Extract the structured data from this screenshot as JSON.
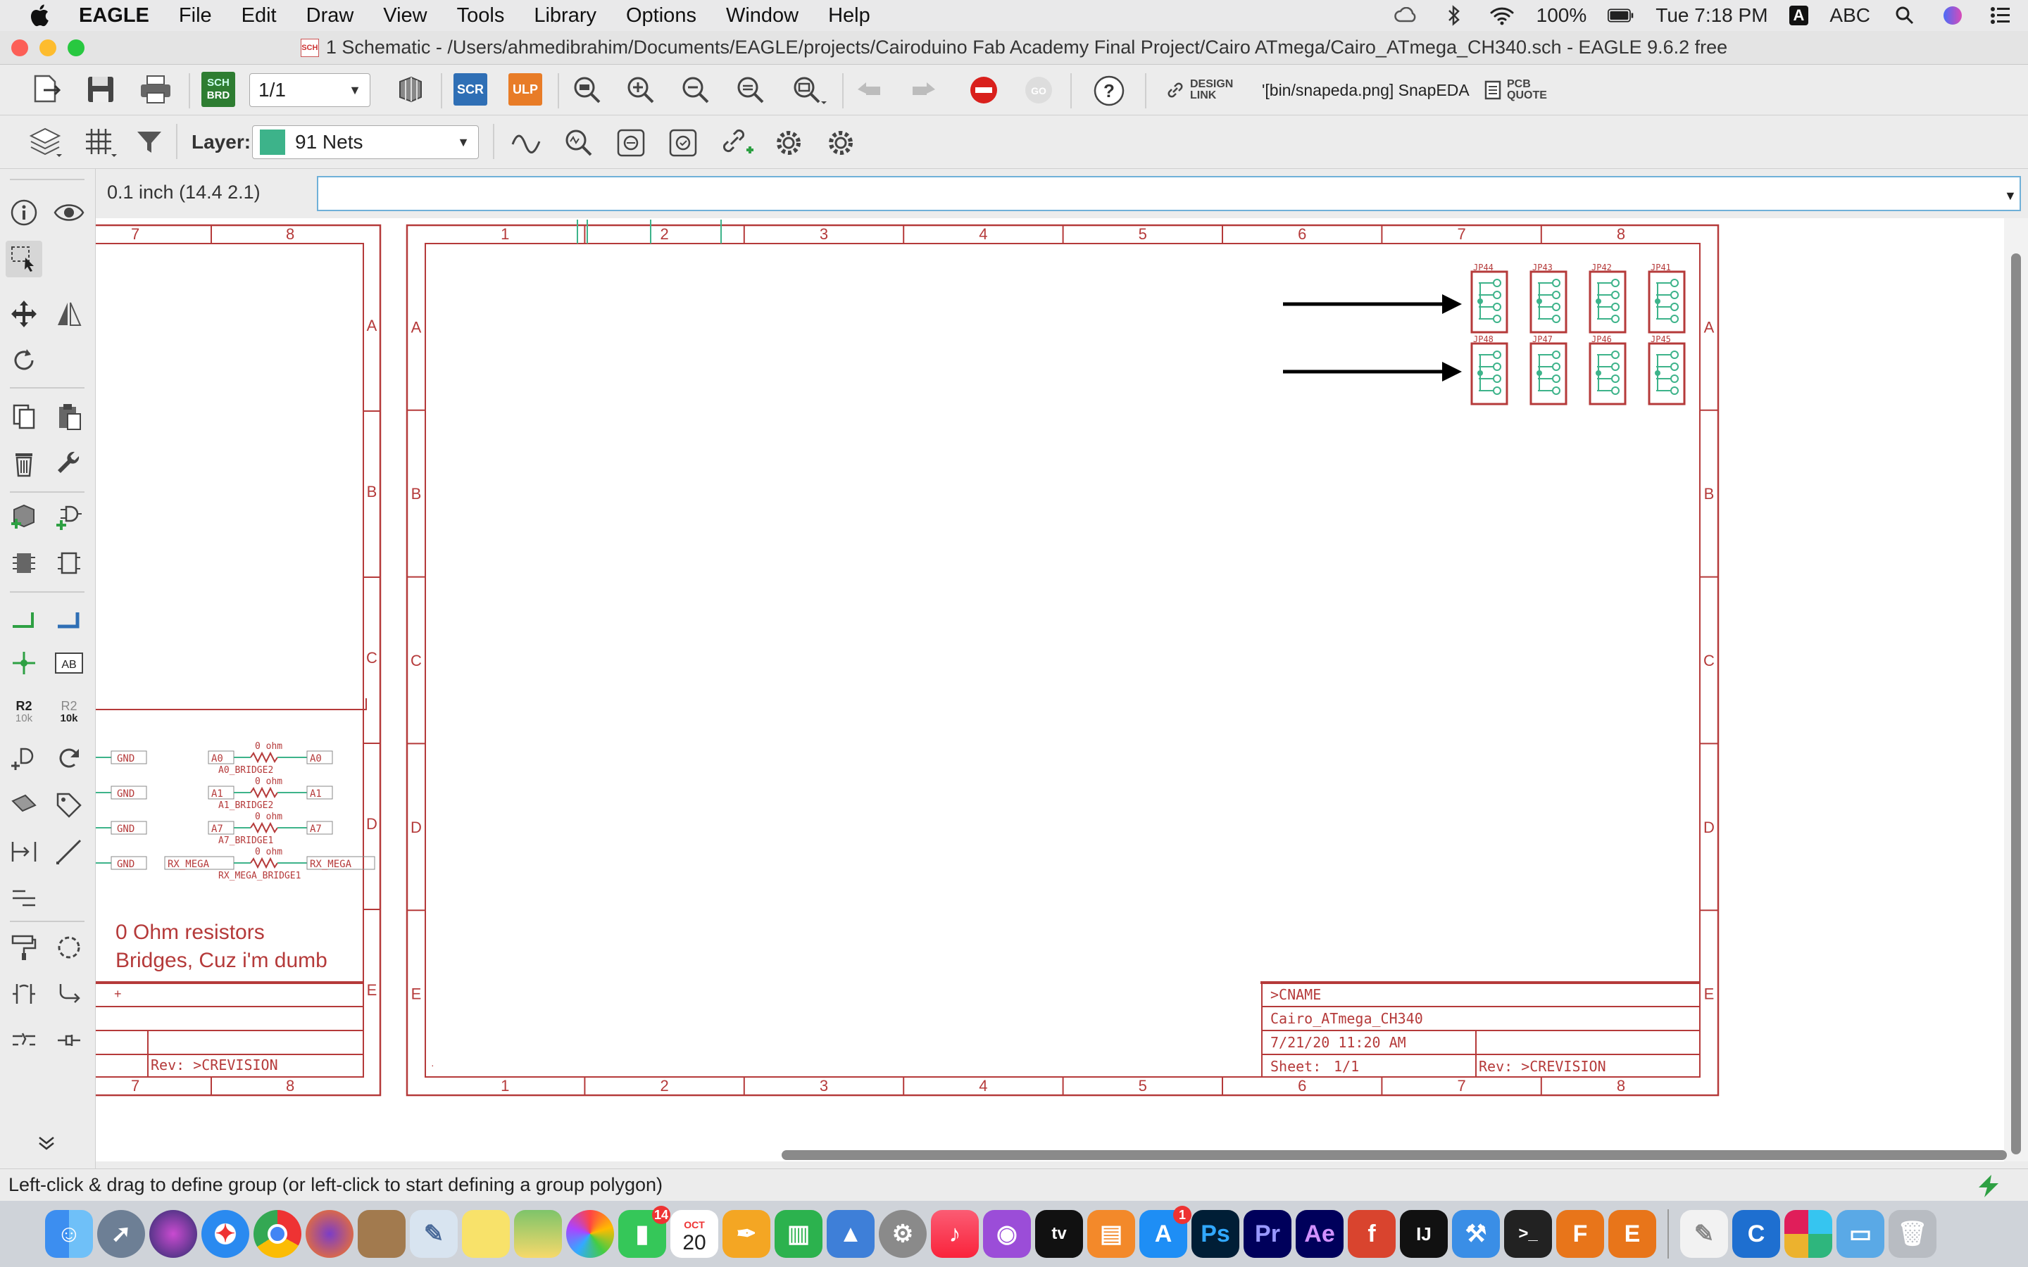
{
  "menubar": {
    "app_name": "EAGLE",
    "items": [
      "File",
      "Edit",
      "Draw",
      "View",
      "Tools",
      "Library",
      "Options",
      "Window",
      "Help"
    ],
    "battery": "100%",
    "clock": "Tue 7:18 PM",
    "input_source": "ABC",
    "input_badge": "A"
  },
  "window": {
    "title": "1 Schematic - /Users/ahmedibrahim/Documents/EAGLE/projects/Cairoduino Fab Academy Final Project/Cairo ATmega/Cairo_ATmega_CH340.sch - EAGLE 9.6.2 free"
  },
  "toolbar": {
    "sheet_select": "1/1",
    "scr_label": "SCR",
    "ulp_label": "ULP",
    "sch_brd_top": "SCH",
    "sch_brd_bottom": "BRD",
    "design_link": "DESIGN\nLINK",
    "snapeda": "'[bin/snapeda.png] SnapEDA",
    "pcb_quote": "PCB\nQUOTE",
    "layer_label": "Layer:",
    "layer_value": "91 Nets",
    "layer_color": "#3db38a"
  },
  "command": {
    "coordinate": "0.1 inch (14.4 2.1)",
    "value": ""
  },
  "palette": {
    "value_top": "R2",
    "value_bottom": "10k",
    "value_top2": "R2",
    "value_bottom2": "10k",
    "text_tool": "AB"
  },
  "schematic": {
    "col_labels": [
      "1",
      "2",
      "3",
      "4",
      "5",
      "6",
      "7",
      "8"
    ],
    "left_col_labels": [
      "7",
      "8"
    ],
    "row_labels": [
      "A",
      "B",
      "C",
      "D",
      "E"
    ],
    "pin_headers_top": [
      "JP44",
      "JP43",
      "JP42",
      "JP41"
    ],
    "pin_headers_bottom": [
      "JP48",
      "JP47",
      "JP46",
      "JP45"
    ],
    "bridges": [
      {
        "left": "A0",
        "right": "A0",
        "name": "A0_BRIDGE2",
        "value": "0 ohm",
        "gnd": "GND"
      },
      {
        "left": "A1",
        "right": "A1",
        "name": "A1_BRIDGE2",
        "value": "0 ohm",
        "gnd": "GND"
      },
      {
        "left": "A7",
        "right": "A7",
        "name": "A7_BRIDGE1",
        "value": "0 ohm",
        "gnd": "GND"
      },
      {
        "left": "RX_MEGA",
        "right": "RX_MEGA",
        "name": "RX_MEGA_BRIDGE1",
        "value": "0 ohm",
        "gnd": "GND"
      }
    ],
    "note_line1": "0 Ohm resistors",
    "note_line2": "Bridges, Cuz i'm dumb",
    "title_block": {
      "cname": ">CNAME",
      "filename": "Cairo_ATmega_CH340",
      "date": "7/21/20 11:20 AM",
      "sheet_label": "Sheet:",
      "sheet_value": "1/1",
      "revision": "Rev: >CREVISION"
    },
    "left_title_revision": "Rev: >CREVISION",
    "colors": {
      "frame": "#b53a3a",
      "net": "#3db38a",
      "arrow": "#000000"
    }
  },
  "status": {
    "message": "Left-click & drag to define group (or left-click to start defining a group polygon)"
  },
  "dock": {
    "facetime_badge": "14",
    "calendar_month": "OCT",
    "calendar_day": "20",
    "appstore_badge": "1",
    "apps": [
      "Finder",
      "Launchpad",
      "Siri",
      "Safari",
      "Chrome",
      "Firefox",
      "Notes",
      "Preview",
      "Stickies",
      "Maps",
      "Photos",
      "FaceTime",
      "Calendar",
      "Pages",
      "Numbers",
      "Keynote",
      "System Preferences",
      "Music",
      "Podcasts",
      "TV",
      "Books",
      "App Store",
      "Ps",
      "Pr",
      "Ae",
      "Fusion",
      "IntelliJ",
      "Xcode",
      "Terminal",
      "F360",
      "EAGLE",
      "Notes2",
      "Cura",
      "Slack",
      "Folder",
      "Trash"
    ],
    "ps": "Ps",
    "pr": "Pr",
    "ae": "Ae",
    "f": "f",
    "ij": "IJ",
    "f360": "F",
    "eagle": "E"
  }
}
